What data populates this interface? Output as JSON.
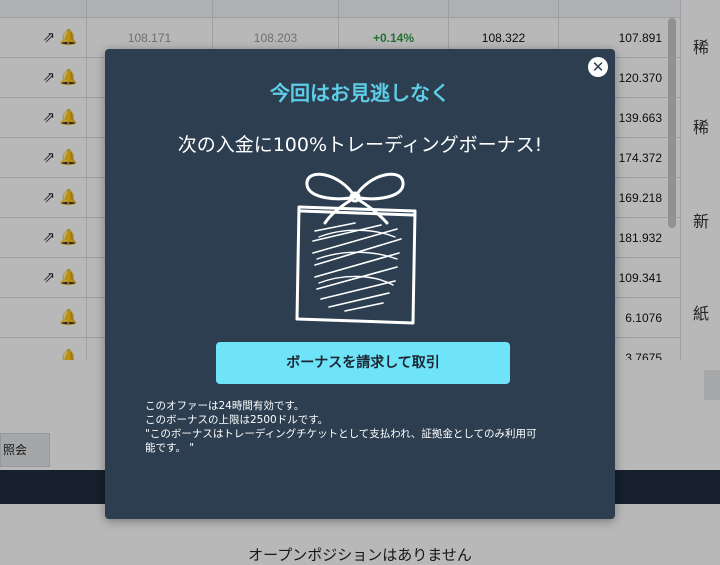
{
  "table": {
    "rows": [
      {
        "icons": "⇗ 🔔",
        "bid": "108.171",
        "ask": "108.203",
        "change": "+0.14%",
        "high": "108.322",
        "low": "107.891"
      },
      {
        "icons": "⇗ 🔔",
        "bid": "",
        "ask": "",
        "change": "",
        "high": "",
        "low": "120.370"
      },
      {
        "icons": "⇗ 🔔",
        "bid": "",
        "ask": "",
        "change": "",
        "high": "",
        "low": "139.663"
      },
      {
        "icons": "⇗ 🔔",
        "bid": "",
        "ask": "",
        "change": "",
        "high": "",
        "low": "174.372"
      },
      {
        "icons": "⇗ 🔔",
        "bid": "",
        "ask": "",
        "change": "",
        "high": "",
        "low": "169.218"
      },
      {
        "icons": "⇗ 🔔",
        "bid": "",
        "ask": "",
        "change": "",
        "high": "",
        "low": "181.932"
      },
      {
        "icons": "⇗ 🔔",
        "bid": "",
        "ask": "",
        "change": "",
        "high": "",
        "low": "109.341"
      },
      {
        "icons": "🔔",
        "bid": "",
        "ask": "",
        "change": "",
        "high": "",
        "low": "6.1076"
      },
      {
        "icons": "🔔",
        "bid": "",
        "ask": "",
        "change": "",
        "high": "",
        "low": "3.7675"
      }
    ],
    "right_column_labels": [
      "稀",
      "稀",
      "新",
      "紙"
    ]
  },
  "tab": {
    "label": "照会"
  },
  "positions": {
    "empty_text": "オープンポジションはありません"
  },
  "modal": {
    "title": "今回はお見逃しなく",
    "subtitle": "次の入金に100%トレーディングボーナス!",
    "close_label": "✕",
    "cta_label": "ボーナスを請求して取引",
    "terms": [
      "このオファーは24時間有効です。",
      "このボーナスの上限は2500ドルです。",
      "\"このボーナスはトレーディングチケットとして支払われ、証拠金としてのみ利用可",
      "能です。 \""
    ]
  },
  "colors": {
    "modal_bg": "#2c3e50",
    "title_accent": "#5ecde6",
    "cta_bg": "#6fe3f7",
    "positive_change": "#2e9e44",
    "nav_bar": "#1f2d3d"
  },
  "icons": [
    "external-link-icon",
    "bell-icon",
    "close-icon",
    "gift-box-icon"
  ]
}
